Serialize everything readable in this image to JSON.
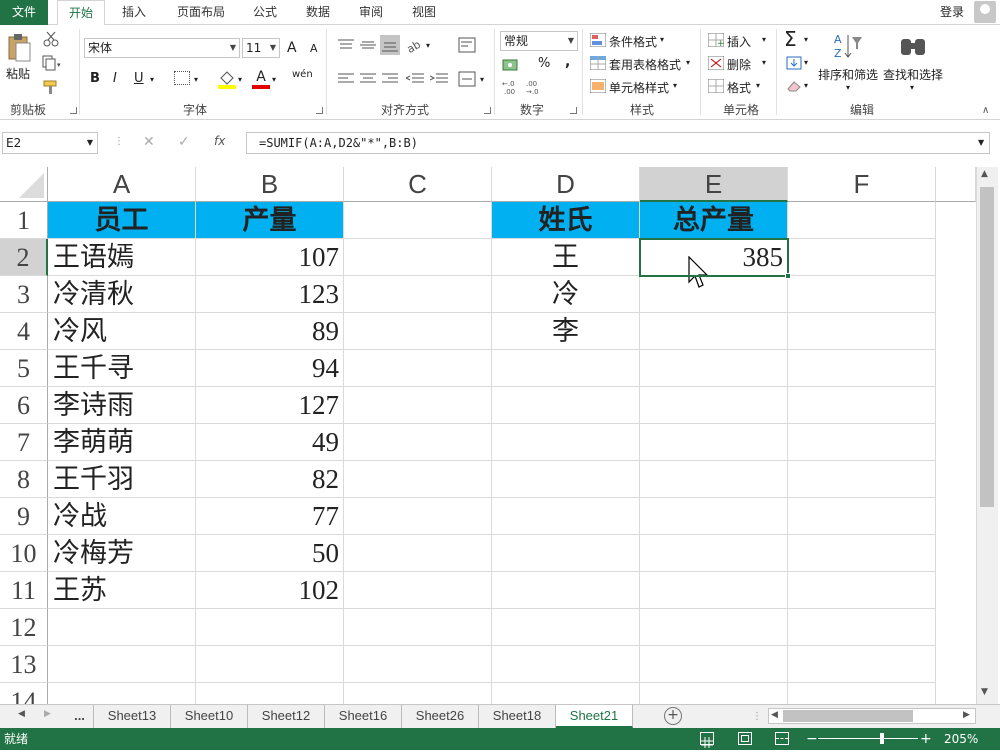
{
  "tabs": {
    "file": "文件",
    "home": "开始",
    "insert": "插入",
    "layout": "页面布局",
    "formulas": "公式",
    "data": "数据",
    "review": "审阅",
    "view": "视图"
  },
  "account": {
    "login": "登录"
  },
  "ribbon": {
    "clipboard": {
      "label": "剪贴板",
      "paste": "粘贴"
    },
    "font": {
      "label": "字体",
      "name": "宋体",
      "size": "11",
      "bold": "B",
      "italic": "I",
      "underline": "U",
      "grow": "A",
      "shrink": "A",
      "color": "A",
      "phonetic": "wén"
    },
    "alignment": {
      "label": "对齐方式"
    },
    "number": {
      "label": "数字",
      "format": "常规",
      "percent": "%",
      "comma": ",",
      "inc_decimal": "←.0\n.00",
      "dec_decimal": ".00\n→.0"
    },
    "styles": {
      "label": "样式",
      "conditional": "条件格式",
      "table": "套用表格格式",
      "cell": "单元格样式"
    },
    "cells": {
      "label": "单元格",
      "insert": "插入",
      "delete": "删除",
      "format": "格式"
    },
    "editing": {
      "label": "编辑",
      "sum": "Σ",
      "sort": "排序和筛选",
      "find": "查找和选择"
    }
  },
  "formula_bar": {
    "name_box": "E2",
    "fx": "fx",
    "formula": "=SUMIF(A:A,D2&\"*\",B:B)",
    "cancel": "✕",
    "enter": "✓"
  },
  "columns": [
    "A",
    "B",
    "C",
    "D",
    "E",
    "F"
  ],
  "rows": [
    "1",
    "2",
    "3",
    "4",
    "5",
    "6",
    "7",
    "8",
    "9",
    "10",
    "11",
    "12",
    "13",
    "14"
  ],
  "table": {
    "header_a": "员工",
    "header_b": "产量",
    "data": [
      {
        "name": "王语嫣",
        "qty": "107"
      },
      {
        "name": "冷清秋",
        "qty": "123"
      },
      {
        "name": "冷风",
        "qty": "89"
      },
      {
        "name": "王千寻",
        "qty": "94"
      },
      {
        "name": "李诗雨",
        "qty": "127"
      },
      {
        "name": "李萌萌",
        "qty": "49"
      },
      {
        "name": "王千羽",
        "qty": "82"
      },
      {
        "name": "冷战",
        "qty": "77"
      },
      {
        "name": "冷梅芳",
        "qty": "50"
      },
      {
        "name": "王苏",
        "qty": "102"
      }
    ]
  },
  "summary": {
    "header_d": "姓氏",
    "header_e": "总产量",
    "surnames": [
      "王",
      "冷",
      "李"
    ],
    "e2": "385"
  },
  "sheets": {
    "more": "...",
    "list": [
      "Sheet13",
      "Sheet10",
      "Sheet12",
      "Sheet16",
      "Sheet26",
      "Sheet18",
      "Sheet21"
    ],
    "active": "Sheet21",
    "add": "+"
  },
  "status": {
    "ready": "就绪",
    "zoom": "205%",
    "zoom_minus": "−",
    "zoom_plus": "+"
  },
  "colors": {
    "excel_green": "#217346",
    "header_fill": "#00b0f0"
  }
}
